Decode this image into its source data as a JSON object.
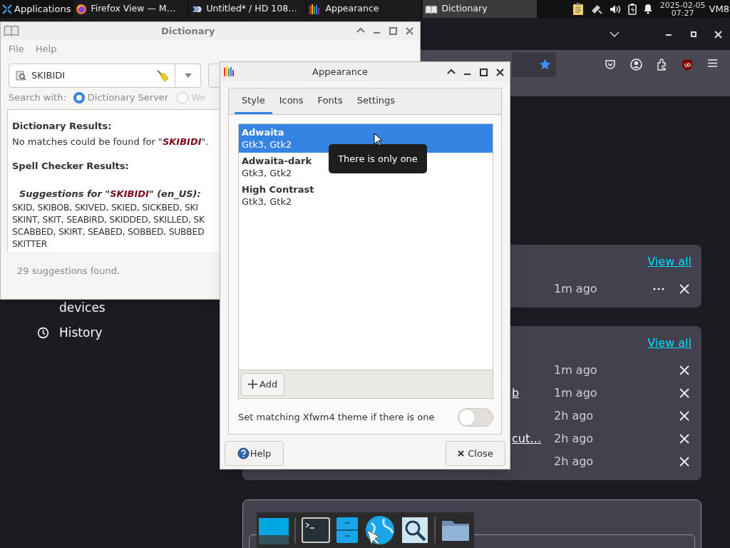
{
  "panel": {
    "menu_label": "Applications",
    "tasks": [
      {
        "label": "Firefox View — M…",
        "selected": false
      },
      {
        "label": "Untitled* / HD 108…",
        "selected": false
      },
      {
        "label": "Appearance",
        "selected": false
      },
      {
        "label": "Dictionary",
        "selected": true
      }
    ],
    "date": "2025-02-05",
    "time": "07:27",
    "host": "VM8"
  },
  "browser": {
    "sidebar": [
      {
        "label": "devices"
      },
      {
        "label": "History"
      }
    ],
    "cards": [
      {
        "link": "View all",
        "rows": [
          {
            "time": "1m ago",
            "has_menu": true
          }
        ]
      },
      {
        "link": "View all",
        "rows": [
          {
            "time": "1m ago",
            "has_menu": false
          },
          {
            "title": "b",
            "time": "1m ago",
            "has_menu": false
          },
          {
            "time": "2h ago",
            "has_menu": false
          },
          {
            "title": "cut…",
            "time": "2h ago",
            "has_menu": false
          },
          {
            "time": "2h ago",
            "has_menu": false
          }
        ]
      }
    ]
  },
  "dictionary": {
    "title": "Dictionary",
    "menu": [
      "File",
      "Help"
    ],
    "search_value": "SKIBIDI",
    "search_with": "Search with:",
    "sources": [
      {
        "label": "Dictionary Server",
        "selected": true
      },
      {
        "label": "We",
        "selected": false
      }
    ],
    "results_heading": "Dictionary Results:",
    "no_match": "No matches could be found for \"**SKIBIDI**\".",
    "spell_heading": "Spell Checker Results:",
    "suggestions_heading": "Suggestions for \"**SKIBIDI**\" (en_US):",
    "suggestion_lines": [
      "SKID, SKIBOB, SKIVED, SKIED, SICKBED, SKI",
      "SKINT, SKIT, SEABIRD, SKIDDED, SKILLED, SK",
      "SCABBED, SKIRT, SEABED, SOBBED, SUBBED",
      "SKITTER"
    ],
    "status": "29 suggestions found."
  },
  "appearance": {
    "title": "Appearance",
    "tabs": [
      {
        "label": "Style",
        "selected": true
      },
      {
        "label": "Icons",
        "selected": false
      },
      {
        "label": "Fonts",
        "selected": false
      },
      {
        "label": "Settings",
        "selected": false
      }
    ],
    "themes": [
      {
        "name": "Adwaita",
        "subtitle": "Gtk3, Gtk2",
        "selected": true
      },
      {
        "name": "Adwaita-dark",
        "subtitle": "Gtk3, Gtk2",
        "selected": false
      },
      {
        "name": "High Contrast",
        "subtitle": "Gtk3, Gtk2",
        "selected": false
      }
    ],
    "add_button": "Add",
    "xfwm_toggle": {
      "label": "Set matching Xfwm4 theme if there is one",
      "on": false
    },
    "help_button": "Help",
    "close_button": "Close",
    "tooltip": "There is only one"
  }
}
